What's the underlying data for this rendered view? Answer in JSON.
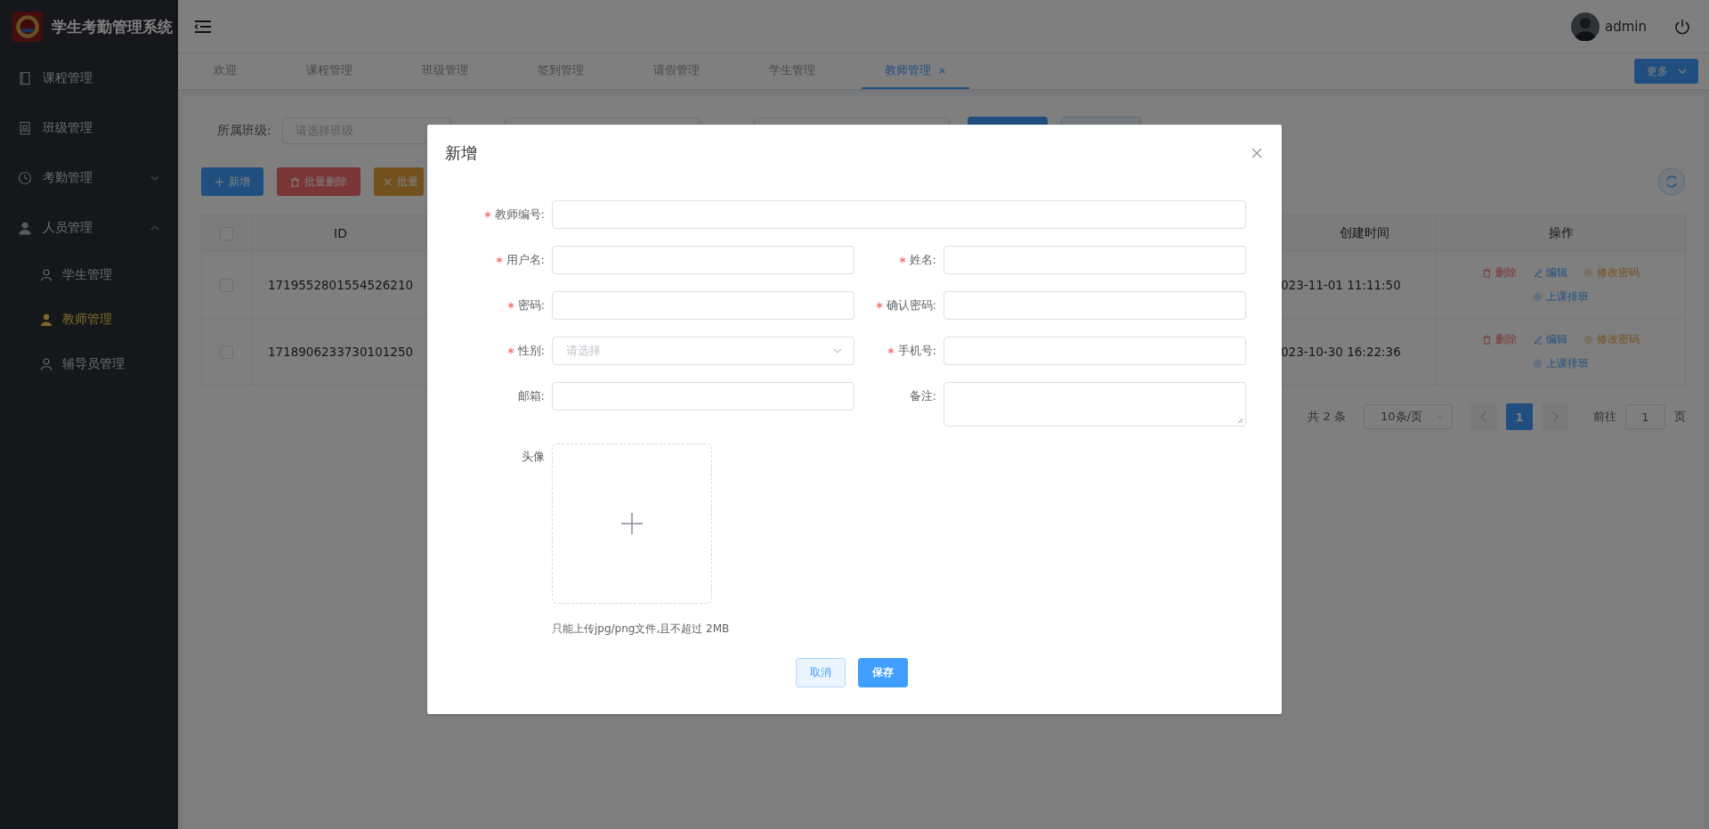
{
  "app": {
    "title": "学生考勤管理系统"
  },
  "sidebar": {
    "items": [
      {
        "label": "课程管理"
      },
      {
        "label": "班级管理"
      },
      {
        "label": "考勤管理",
        "expanded": false
      },
      {
        "label": "人员管理",
        "expanded": true,
        "children": [
          {
            "label": "学生管理",
            "selected": false
          },
          {
            "label": "教师管理",
            "selected": true
          },
          {
            "label": "辅导员管理",
            "selected": false
          }
        ]
      }
    ]
  },
  "header": {
    "user": "admin"
  },
  "tabs": [
    {
      "label": "欢迎",
      "selected": false
    },
    {
      "label": "课程管理",
      "selected": false
    },
    {
      "label": "班级管理",
      "selected": false
    },
    {
      "label": "签到管理",
      "selected": false
    },
    {
      "label": "请假管理",
      "selected": false
    },
    {
      "label": "学生管理",
      "selected": false
    },
    {
      "label": "教师管理",
      "selected": true
    }
  ],
  "more_button": "更多",
  "filter": {
    "label": "所属班级:",
    "placeholder": "请选择班级"
  },
  "toolbar": [
    {
      "label": "新增",
      "kind": "add"
    },
    {
      "label": "批量删除",
      "kind": "delete"
    },
    {
      "label": "批量",
      "kind": "cancel"
    }
  ],
  "table": {
    "header_checked": false,
    "columns": [
      "ID",
      "创建时间",
      "操作"
    ],
    "rows": [
      {
        "checked": false,
        "id": "1719552801554526210",
        "created": "023-11-01 11:11:50",
        "actions": [
          {
            "label": "删除",
            "kind": "delete"
          },
          {
            "label": "编辑",
            "kind": "edit"
          },
          {
            "label": "修改密码",
            "kind": "password"
          },
          {
            "label": "上课排班",
            "kind": "schedule"
          }
        ]
      },
      {
        "checked": false,
        "id": "1718906233730101250",
        "created": "023-10-30 16:22:36",
        "actions": [
          {
            "label": "删除",
            "kind": "delete"
          },
          {
            "label": "编辑",
            "kind": "edit"
          },
          {
            "label": "修改密码",
            "kind": "password"
          },
          {
            "label": "上课排班",
            "kind": "schedule"
          }
        ]
      }
    ]
  },
  "pagination": {
    "total": "共 2 条",
    "page_size": "10条/页",
    "pages": [
      {
        "label": "1",
        "selected": true
      }
    ],
    "goto_label": "前往",
    "goto_value": "1",
    "goto_suffix": "页"
  },
  "dialog": {
    "title": "新增",
    "fields": [
      {
        "label": "教师编号:",
        "required": true,
        "kind": "input",
        "full_width": true
      },
      {
        "label": "用户名:",
        "required": true,
        "kind": "input",
        "full_width": false
      },
      {
        "label": "姓名:",
        "required": true,
        "kind": "input",
        "full_width": false
      },
      {
        "label": "密码:",
        "required": true,
        "kind": "input",
        "full_width": false
      },
      {
        "label": "确认密码:",
        "required": true,
        "kind": "input",
        "full_width": false
      },
      {
        "label": "性别:",
        "required": true,
        "kind": "select",
        "full_width": false,
        "placeholder": "请选择"
      },
      {
        "label": "手机号:",
        "required": true,
        "kind": "input",
        "full_width": false
      },
      {
        "label": "邮箱:",
        "required": false,
        "kind": "input",
        "full_width": false
      },
      {
        "label": "备注:",
        "required": false,
        "kind": "textarea",
        "full_width": false
      }
    ],
    "avatar": {
      "label": "头像",
      "hint": "只能上传jpg/png文件,且不超过 2MB"
    },
    "buttons": [
      {
        "label": "取消",
        "kind": "secondary"
      },
      {
        "label": "保存",
        "kind": "primary"
      }
    ]
  }
}
